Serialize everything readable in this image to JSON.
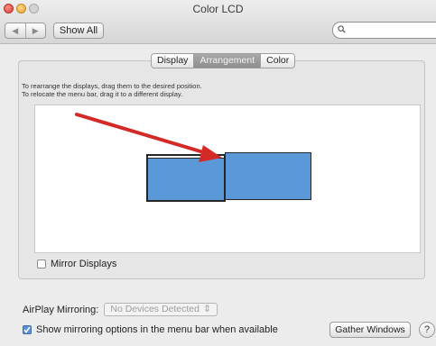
{
  "window": {
    "title": "Color LCD"
  },
  "toolbar": {
    "back_glyph": "◀",
    "forward_glyph": "▶",
    "show_all_label": "Show All",
    "search_placeholder": ""
  },
  "tabs": [
    {
      "label": "Display",
      "active": false
    },
    {
      "label": "Arrangement",
      "active": true
    },
    {
      "label": "Color",
      "active": false
    }
  ],
  "arrangement": {
    "instruction_line1": "To rearrange the displays, drag them to the desired position.",
    "instruction_line2": "To relocate the menu bar, drag it to a different display."
  },
  "options": {
    "mirror_displays_label": "Mirror Displays",
    "mirror_displays_checked": false,
    "airplay_label": "AirPlay Mirroring:",
    "airplay_value": "No Devices Detected",
    "show_mirroring_label": "Show mirroring options in the menu bar when available",
    "show_mirroring_checked": true,
    "gather_windows_label": "Gather Windows",
    "help_label": "?"
  },
  "colors": {
    "display_fill": "#5b98d8",
    "annotation_arrow": "#d42a27",
    "active_tab": "#959595"
  }
}
